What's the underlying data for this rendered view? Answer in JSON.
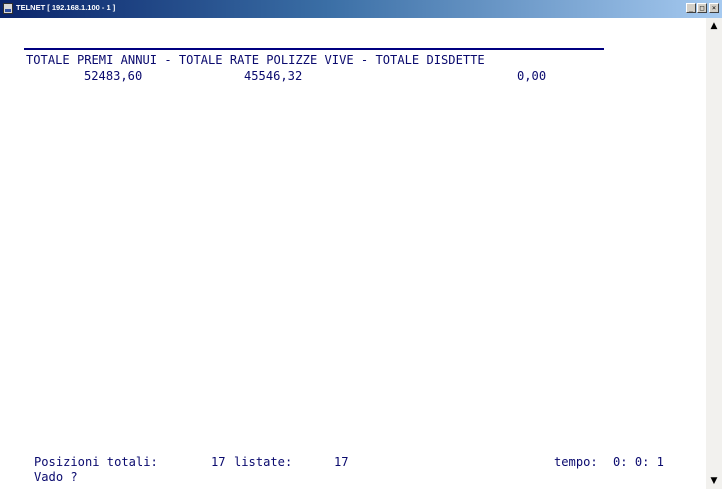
{
  "window": {
    "title": "TELNET [ 192.168.1.100 - 1 ]",
    "minimize_glyph": "_",
    "maximize_glyph": "□",
    "close_glyph": "×"
  },
  "screen": {
    "header_line": "TOTALE PREMI ANNUI - TOTALE RATE POLIZZE VIVE - TOTALE DISDETTE",
    "totale_premi_annui": "52483,60",
    "totale_rate_polizze_vive": "45546,32",
    "totale_disdette": "0,00",
    "status": {
      "posizioni_label": "Posizioni totali:",
      "posizioni_value": "17",
      "listate_label": "listate:",
      "listate_value": "17",
      "tempo_label": "tempo:",
      "tempo_value": "0: 0: 1"
    },
    "prompt": "Vado ?"
  },
  "scrollbar": {
    "up_glyph": "▲",
    "down_glyph": "▼"
  }
}
